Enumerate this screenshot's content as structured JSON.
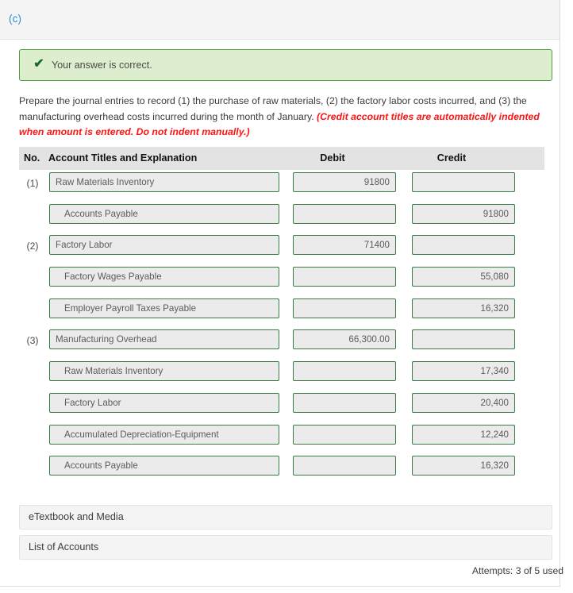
{
  "part_label": "(c)",
  "banner": {
    "icon": "check-icon",
    "text": "Your answer is correct.",
    "bg_color": "#ddeecf",
    "border_color": "#4e9a3d",
    "check_color": "#1c6b2c"
  },
  "instructions": {
    "main": "Prepare the journal entries to record (1) the purchase of raw materials, (2) the factory labor costs incurred, and (3) the manufacturing overhead costs incurred during the month of January. ",
    "hint": "(Credit account titles are automatically indented when amount is entered. Do not indent manually.)",
    "hint_color": "#ff1414"
  },
  "table": {
    "headers": {
      "no": "No.",
      "account": "Account Titles and Explanation",
      "debit": "Debit",
      "credit": "Credit"
    },
    "rows": [
      {
        "no": "(1)",
        "account": "Raw Materials Inventory",
        "indented": false,
        "debit": "91800",
        "credit": ""
      },
      {
        "no": "",
        "account": "Accounts Payable",
        "indented": true,
        "debit": "",
        "credit": "91800"
      },
      {
        "no": "(2)",
        "account": "Factory Labor",
        "indented": false,
        "debit": "71400",
        "credit": ""
      },
      {
        "no": "",
        "account": "Factory Wages Payable",
        "indented": true,
        "debit": "",
        "credit": "55,080"
      },
      {
        "no": "",
        "account": "Employer Payroll Taxes Payable",
        "indented": true,
        "debit": "",
        "credit": "16,320"
      },
      {
        "no": "(3)",
        "account": "Manufacturing Overhead",
        "indented": false,
        "debit": "66,300.00",
        "credit": ""
      },
      {
        "no": "",
        "account": "Raw Materials Inventory",
        "indented": true,
        "debit": "",
        "credit": "17,340"
      },
      {
        "no": "",
        "account": "Factory Labor",
        "indented": true,
        "debit": "",
        "credit": "20,400"
      },
      {
        "no": "",
        "account": "Accumulated Depreciation-Equipment",
        "indented": true,
        "debit": "",
        "credit": "12,240"
      },
      {
        "no": "",
        "account": "Accounts Payable",
        "indented": true,
        "debit": "",
        "credit": "16,320"
      }
    ]
  },
  "footer": {
    "etextbook_label": "eTextbook and Media",
    "accounts_label": "List of Accounts",
    "attempts": "Attempts: 3 of 5 used"
  }
}
